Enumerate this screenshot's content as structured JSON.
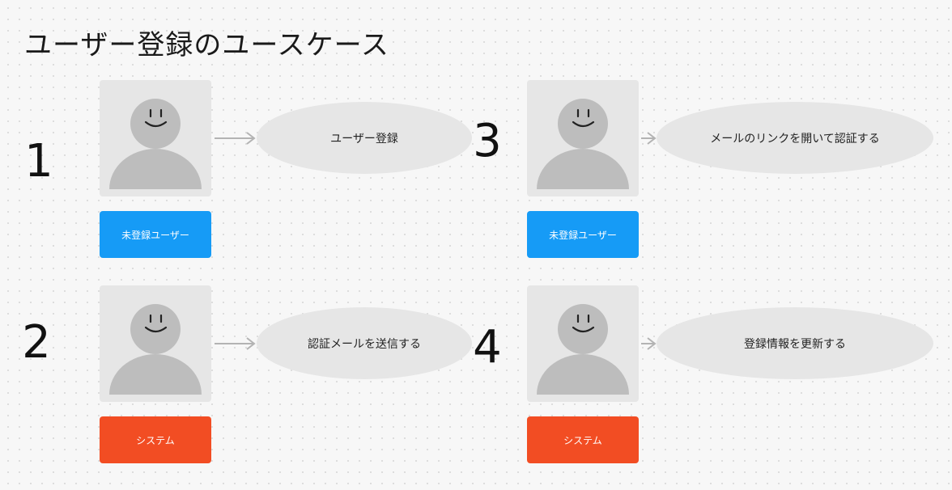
{
  "diagram": {
    "title": "ユーザー登録のユースケース",
    "colors": {
      "user_badge": "#169bf6",
      "system_badge": "#f24d23",
      "card": "#e6e6e6",
      "avatar": "#bdbdbd",
      "arrow": "#b3b3b3"
    },
    "steps": [
      {
        "number": "1",
        "actor": "未登録ユーザー",
        "actor_kind": "user",
        "usecase": "ユーザー登録"
      },
      {
        "number": "2",
        "actor": "システム",
        "actor_kind": "system",
        "usecase": "認証メールを送信する"
      },
      {
        "number": "3",
        "actor": "未登録ユーザー",
        "actor_kind": "user",
        "usecase": "メールのリンクを開いて認証する"
      },
      {
        "number": "4",
        "actor": "システム",
        "actor_kind": "system",
        "usecase": "登録情報を更新する"
      }
    ]
  }
}
